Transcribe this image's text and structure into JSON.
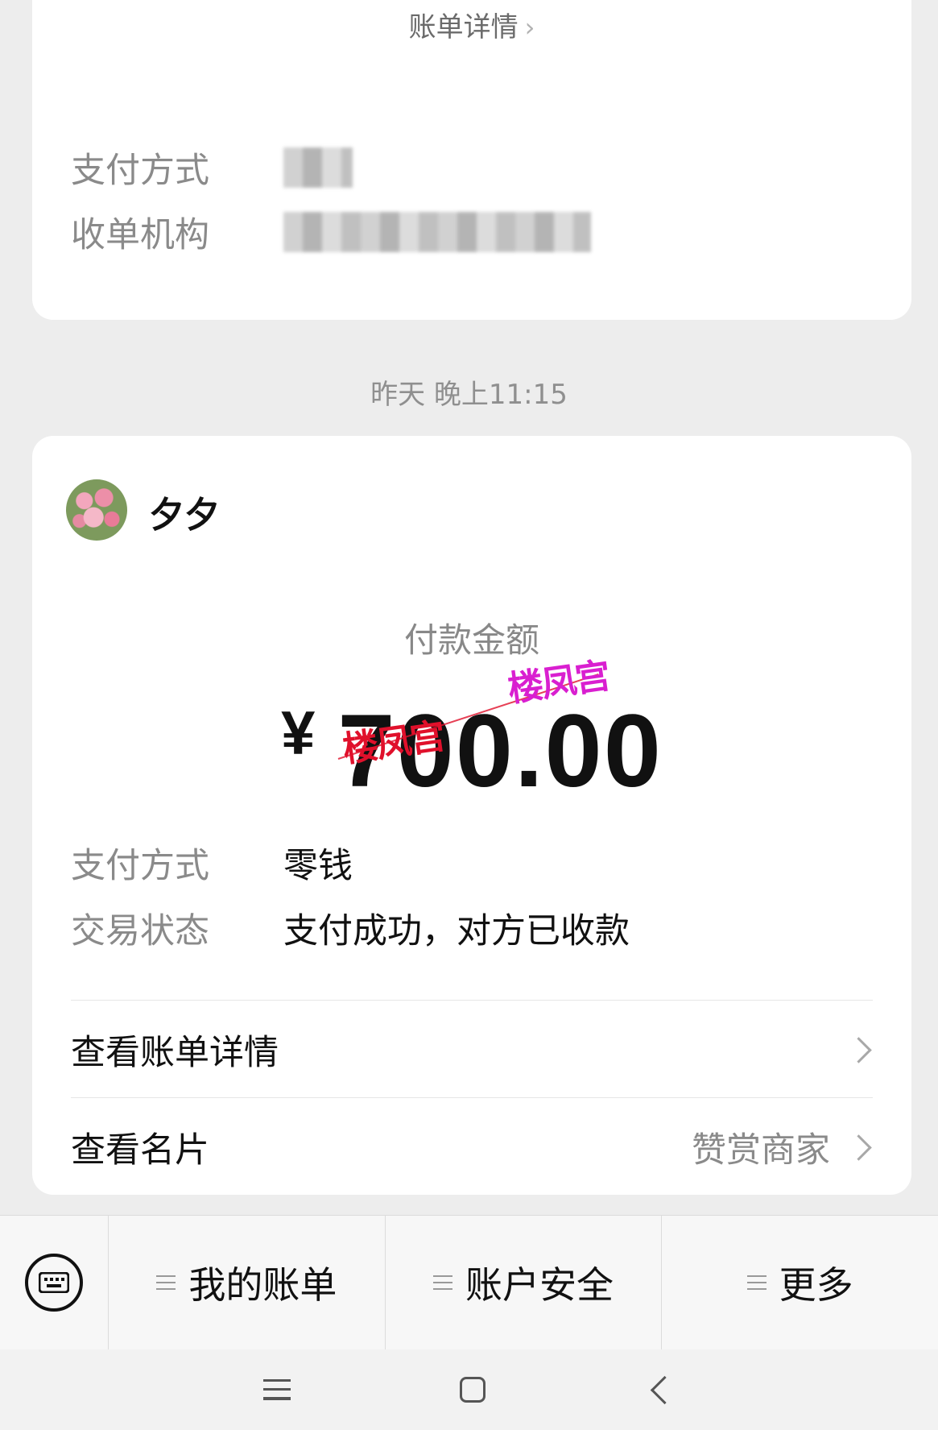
{
  "top_card": {
    "bill_link": "账单详情",
    "pay_method_label": "支付方式",
    "acquirer_label": "收单机构"
  },
  "timestamp": "昨天 晚上11:15",
  "main_card": {
    "username": "夕夕",
    "amount_label": "付款金额",
    "currency": "¥",
    "amount": "700.00",
    "watermark": "楼凤宫",
    "pay_method_label": "支付方式",
    "pay_method_value": "零钱",
    "status_label": "交易状态",
    "status_value": "支付成功，对方已收款",
    "view_bill": "查看账单详情",
    "view_card": "查看名片",
    "reward_merchant": "赞赏商家"
  },
  "bottom_menu": {
    "items": [
      "我的账单",
      "账户安全",
      "更多"
    ]
  },
  "icons": {
    "keyboard": "keyboard-icon",
    "chevron": "chevron-right-icon",
    "menu": "hamburger-icon",
    "nav_menu": "nav-recents-icon",
    "nav_home": "nav-home-icon",
    "nav_back": "nav-back-icon"
  }
}
